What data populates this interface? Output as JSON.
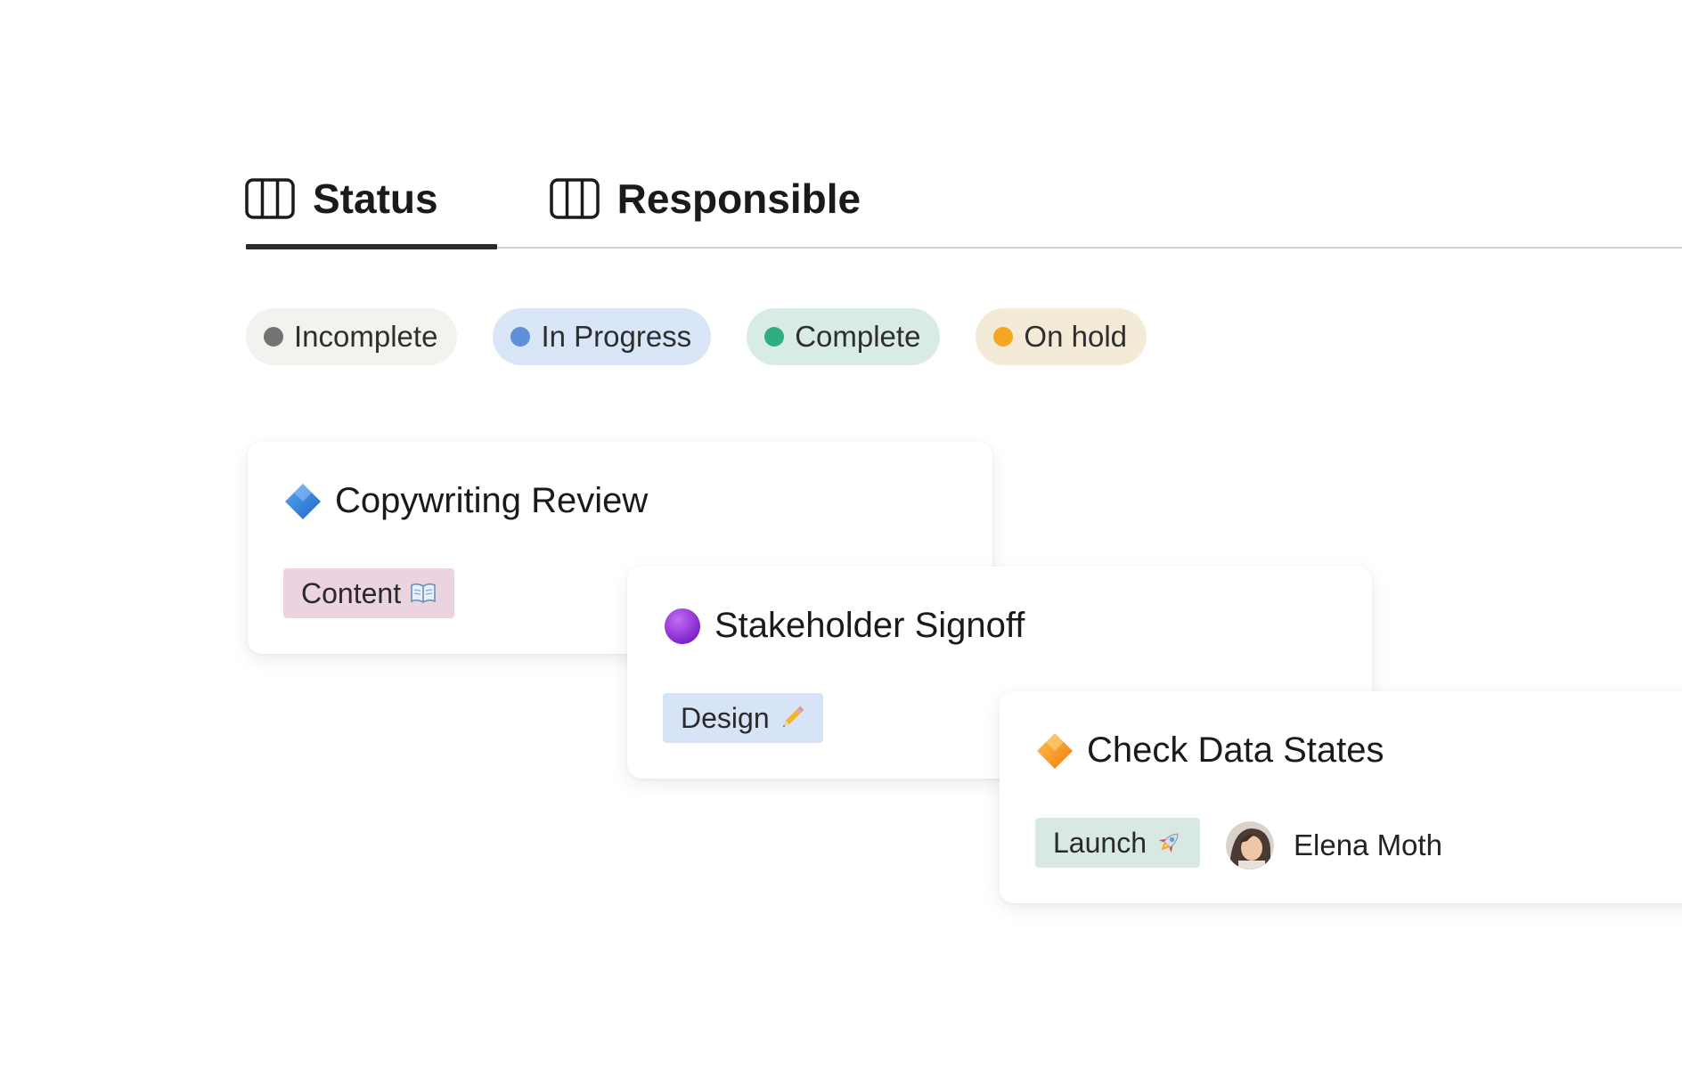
{
  "tabs": [
    {
      "label": "Status",
      "icon": "board-columns-icon",
      "active": true
    },
    {
      "label": "Responsible",
      "icon": "board-columns-icon",
      "active": false
    }
  ],
  "statuses": [
    {
      "label": "Incomplete",
      "dot": "#737373",
      "bg": "#f3f2ef"
    },
    {
      "label": "In Progress",
      "dot": "#5f8fd6",
      "bg": "#d9e6f8"
    },
    {
      "label": "Complete",
      "dot": "#2fae7f",
      "bg": "#d8ebe4"
    },
    {
      "label": "On hold",
      "dot": "#f5a623",
      "bg": "#f4ead8"
    }
  ],
  "cards": [
    {
      "title": "Copywriting Review",
      "icon": "blue-diamond-icon",
      "tag": {
        "label": "Content",
        "icon": "open-book-icon",
        "bg": "#ebd3df"
      }
    },
    {
      "title": "Stakeholder Signoff",
      "icon": "purple-circle-icon",
      "tag": {
        "label": "Design",
        "icon": "pencil-icon",
        "bg": "#d7e4f7"
      }
    },
    {
      "title": "Check Data States",
      "icon": "orange-diamond-icon",
      "tag": {
        "label": "Launch",
        "icon": "rocket-icon",
        "bg": "#d8e8e2"
      },
      "assignee": {
        "name": "Elena Moth",
        "avatar": "avatar"
      }
    }
  ]
}
